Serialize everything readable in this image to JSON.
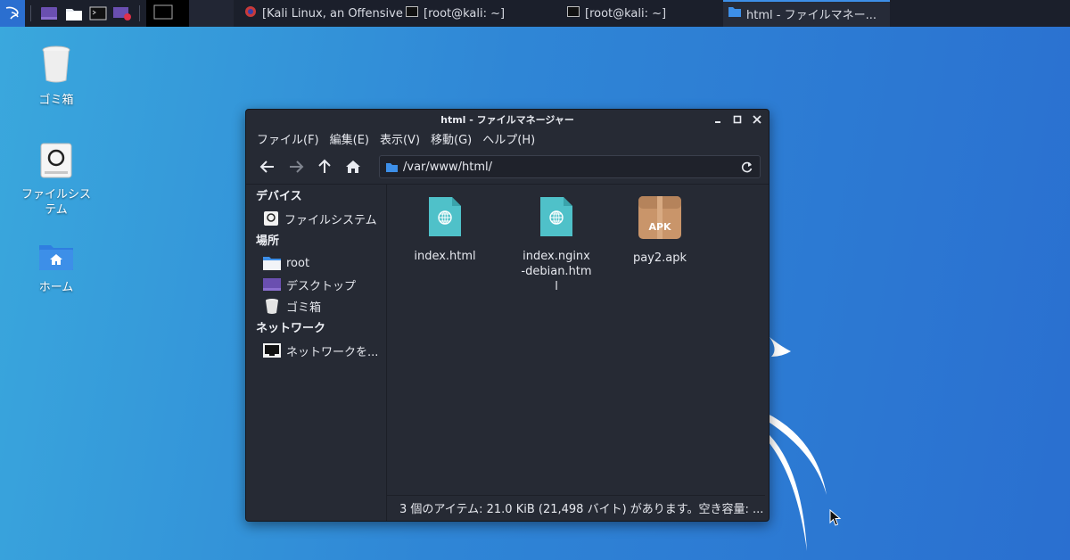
{
  "taskbar": {
    "launchers": [
      "kali-menu-icon",
      "terminal-icon",
      "file-manager-icon",
      "terminal-emulator-icon",
      "screen-recorder-icon"
    ],
    "tasks": [
      {
        "label": "[Kali Linux, an Offensive ...",
        "icon": "browser-icon"
      },
      {
        "label": "[root@kali: ~]",
        "icon": "terminal-icon"
      },
      {
        "label": "[root@kali: ~]",
        "icon": "terminal-icon"
      },
      {
        "label": "html - ファイルマネー...",
        "icon": "folder-icon",
        "active": true
      }
    ]
  },
  "desktop": {
    "icons": [
      {
        "label": "ゴミ箱",
        "icon": "trash-icon"
      },
      {
        "label": "ファイルシステム",
        "icon": "drive-icon"
      },
      {
        "label": "ホーム",
        "icon": "home-folder-icon"
      }
    ]
  },
  "window": {
    "title": "html - ファイルマネージャー",
    "menu": [
      "ファイル(F)",
      "編集(E)",
      "表示(V)",
      "移動(G)",
      "ヘルプ(H)"
    ],
    "path": "/var/www/html/",
    "sidebar": {
      "sections": [
        {
          "header": "デバイス",
          "items": [
            {
              "label": "ファイルシステム",
              "icon": "drive-icon"
            }
          ]
        },
        {
          "header": "場所",
          "items": [
            {
              "label": "root",
              "icon": "folder-icon"
            },
            {
              "label": "デスクトップ",
              "icon": "desktop-icon"
            },
            {
              "label": "ゴミ箱",
              "icon": "trash-icon"
            }
          ]
        },
        {
          "header": "ネットワーク",
          "items": [
            {
              "label": "ネットワークを...",
              "icon": "network-icon"
            }
          ]
        }
      ]
    },
    "files": [
      {
        "name": "index.html",
        "icon": "html-file-icon"
      },
      {
        "name": "index.nginx-debian.html",
        "icon": "html-file-icon"
      },
      {
        "name": "pay2.apk",
        "icon": "apk-file-icon",
        "badge": "APK"
      }
    ],
    "status": "3 個のアイテム: 21.0 KiB (21,498 バイト) があります。空き容量: ..."
  },
  "colors": {
    "accent": "#3d8fe8",
    "html_file": "#4fc1c9",
    "apk_file": "#c9956a",
    "window_bg": "#262a34"
  }
}
